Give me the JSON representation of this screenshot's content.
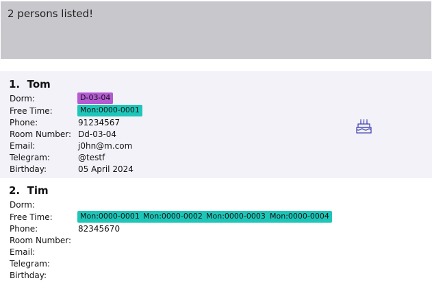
{
  "result": {
    "text": "2 persons listed!"
  },
  "persons": [
    {
      "index": "1.",
      "name": "Tom",
      "labels": {
        "dorm": "Dorm:",
        "free_time": "Free Time:",
        "phone": "Phone:",
        "room": "Room Number:",
        "email": "Email:",
        "telegram": "Telegram:",
        "birthday": "Birthday:"
      },
      "dorm_tag": "D-03-04",
      "free_time_tags": [
        "Mon:0000-0001"
      ],
      "phone": "91234567",
      "room": "Dd-03-04",
      "email": "j0hn@m.com",
      "telegram": "@testf",
      "birthday": "05 April 2024",
      "icon": "birthday-cake-icon"
    },
    {
      "index": "2.",
      "name": "Tim",
      "labels": {
        "dorm": "Dorm:",
        "free_time": "Free Time:",
        "phone": "Phone:",
        "room": "Room Number:",
        "email": "Email:",
        "telegram": "Telegram:",
        "birthday": "Birthday:"
      },
      "free_time_tags": [
        "Mon:0000-0001",
        "Mon:0000-0002",
        "Mon:0000-0003",
        "Mon:0000-0004"
      ],
      "phone": "82345670"
    }
  ],
  "colors": {
    "result_bg": "#c8c7cc",
    "card_selected_bg": "#f2f2f8",
    "dorm_tag": "#b55ad2",
    "free_time_tag": "#1ec6b9",
    "icon": "#3a3ab0"
  }
}
